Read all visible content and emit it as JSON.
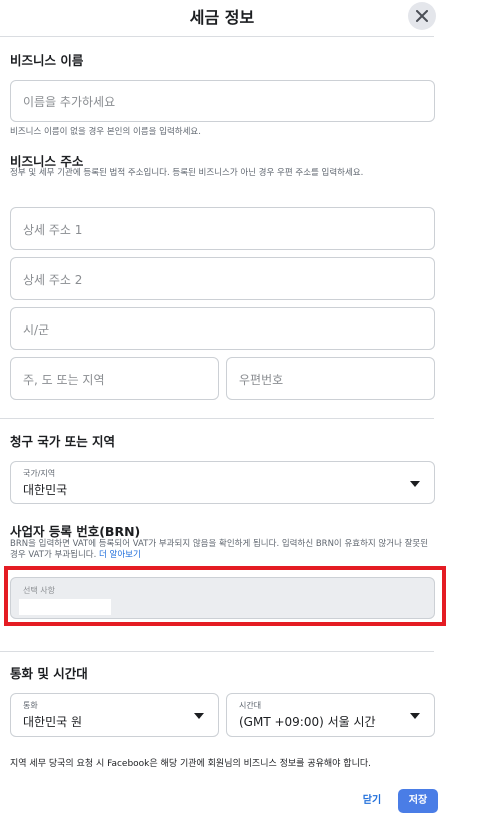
{
  "header": {
    "title": "세금 정보",
    "close_icon": "close-icon"
  },
  "business_name": {
    "label": "비즈니스 이름",
    "placeholder": "이름을 추가하세요",
    "help": "비즈니스 이름이 없을 경우 본인의 이름을 입력하세요."
  },
  "business_address": {
    "label": "비즈니스 주소",
    "help": "정부 및 세무 기관에 등록된 법적 주소입니다. 등록된 비즈니스가 아닌 경우 우편 주소를 입력하세요.",
    "line1_placeholder": "상세 주소 1",
    "line2_placeholder": "상세 주소 2",
    "city_placeholder": "시/군",
    "state_placeholder": "주, 도 또는 지역",
    "zip_placeholder": "우편번호"
  },
  "billing_country": {
    "label": "청구 국가 또는 지역",
    "select_label": "국가/지역",
    "select_value": "대한민국"
  },
  "brn": {
    "label": "사업자 등록 번호(BRN)",
    "help": "BRN을 입력하면 VAT에 등록되어 VAT가 부과되지 않음을 확인하게 됩니다. 입력하신 BRN이 유효하지 않거나 잘못된 경우 VAT가 부과됩니다.",
    "help_link": "더 알아보기",
    "placeholder": "선택 사항"
  },
  "currency_timezone": {
    "label": "통화 및 시간대",
    "currency_label": "통화",
    "currency_value": "대한민국 원",
    "timezone_label": "시간대",
    "timezone_value": "(GMT +09:00) 서울 시간"
  },
  "footnote": "지역 세무 당국의 요청 시 Facebook은 해당 기관에 회원님의 비즈니스 정보를 공유해야 합니다.",
  "buttons": {
    "close_label": "닫기",
    "save_label": "저장"
  },
  "colors": {
    "accent": "#216fdb",
    "save_button": "#4a7de6",
    "highlight": "#e41c23"
  }
}
